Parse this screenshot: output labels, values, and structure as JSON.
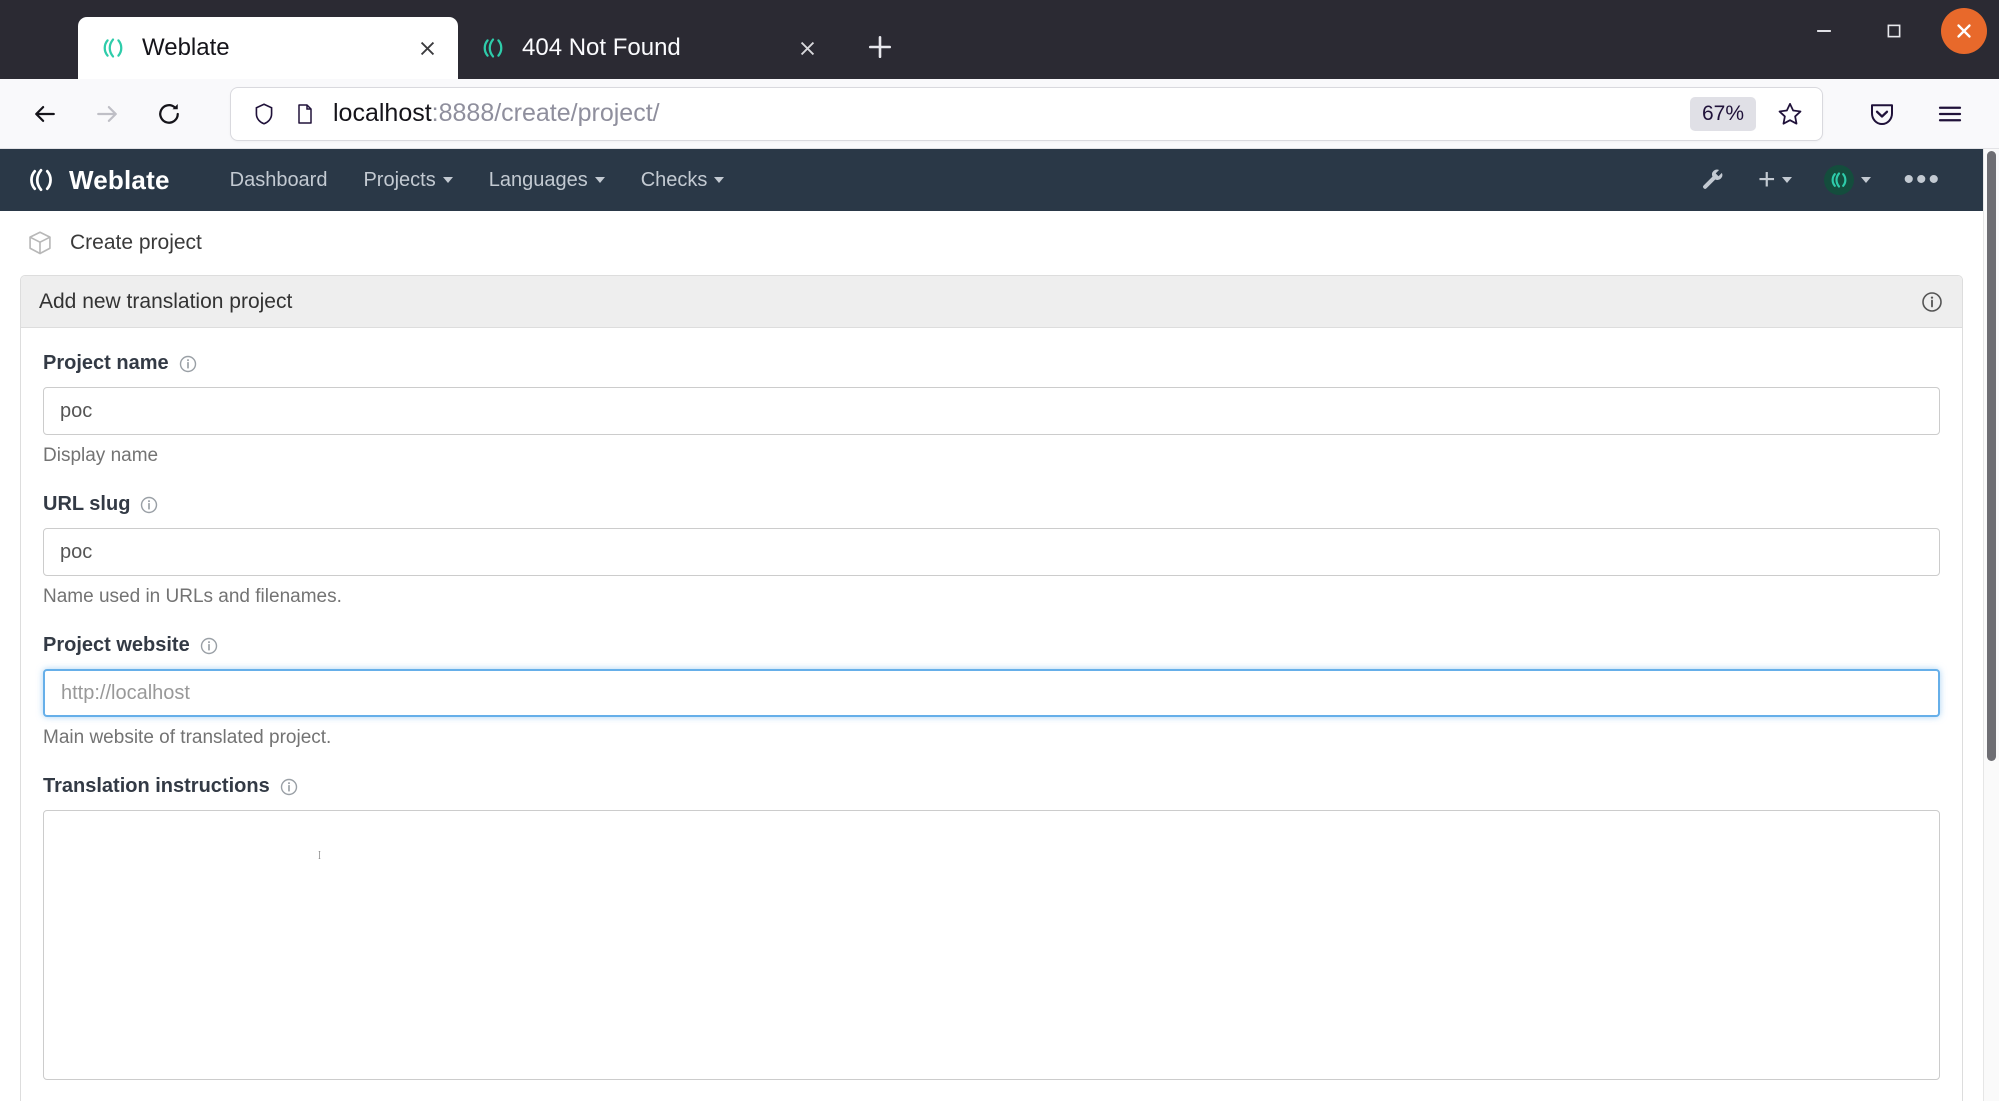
{
  "browser": {
    "tabs": [
      {
        "title": "Weblate",
        "favicon": "weblate-icon",
        "active": true,
        "close_label": "Close tab"
      },
      {
        "title": "404 Not Found",
        "favicon": "weblate-icon",
        "active": false,
        "close_label": "Close tab"
      }
    ],
    "new_tab_label": "+",
    "window_controls": {
      "minimize": "–",
      "maximize": "□",
      "close": "✕"
    },
    "toolbar": {
      "back": "back-arrow",
      "forward": "forward-arrow",
      "reload": "reload",
      "shield_icon": "shield-icon",
      "page_icon": "page-icon",
      "url_host": "localhost",
      "url_rest": ":8888/create/project/",
      "url_full": "localhost:8888/create/project/",
      "zoom_level": "67%",
      "bookmark": "star-icon",
      "pocket": "pocket-icon",
      "menu": "hamburger-icon"
    }
  },
  "site": {
    "brand": "Weblate",
    "nav_links": [
      {
        "label": "Dashboard",
        "has_caret": false
      },
      {
        "label": "Projects",
        "has_caret": true
      },
      {
        "label": "Languages",
        "has_caret": true
      },
      {
        "label": "Checks",
        "has_caret": true
      }
    ],
    "nav_right": {
      "tools_icon": "wrench-icon",
      "add_label": "+",
      "user_avatar": "weblate-avatar",
      "more_label": "•••"
    },
    "breadcrumb": {
      "icon": "project-box-icon",
      "label": "Create project"
    }
  },
  "panel": {
    "title": "Add new translation project",
    "info_icon": "info-circle-icon",
    "fields": [
      {
        "label": "Project name",
        "info_icon": "info-circle-icon",
        "value": "poc",
        "placeholder": "",
        "help": "Display name",
        "type": "text",
        "focused": false
      },
      {
        "label": "URL slug",
        "info_icon": "info-circle-icon",
        "value": "poc",
        "placeholder": "",
        "help": "Name used in URLs and filenames.",
        "type": "text",
        "focused": false
      },
      {
        "label": "Project website",
        "info_icon": "info-circle-icon",
        "value": "",
        "placeholder": "http://localhost",
        "help": "Main website of translated project.",
        "type": "text",
        "focused": true
      },
      {
        "label": "Translation instructions",
        "info_icon": "info-circle-icon",
        "value": "",
        "placeholder": "",
        "help": "",
        "type": "textarea",
        "focused": false
      }
    ]
  },
  "colors": {
    "chrome_dark": "#2b2a33",
    "weblate_navy": "#2a3847",
    "weblate_teal": "#2eccaa",
    "close_highlight": "#e8692b",
    "focus_blue": "#66afe9"
  }
}
